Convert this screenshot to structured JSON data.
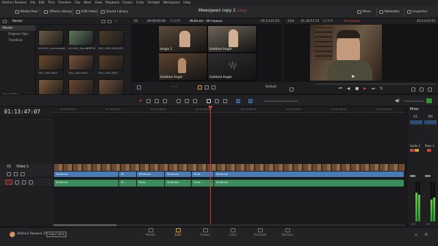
{
  "menu": [
    "DaVinci Resolve",
    "File",
    "Edit",
    "Trim",
    "Timeline",
    "Clip",
    "Mark",
    "View",
    "Playback",
    "Fusion",
    "Color",
    "Fairlight",
    "Workspace",
    "Help"
  ],
  "toolbar": {
    "media_pool": "Media Pool",
    "effects_library": "Effects Library",
    "edit_index": "Edit Index",
    "sound_library": "Sound Library",
    "project_title": "Мемориал copy 2",
    "edited": "Edited",
    "mixer": "Mixer",
    "metadata": "Metadata",
    "inspector": "Inspector"
  },
  "bin_header": {
    "title": "Master"
  },
  "bins": [
    "Master",
    "Original Clips",
    "Timelines"
  ],
  "smart_bins": "Smart Bins",
  "clips": [
    {
      "label": "A2-0001_uncheckedA...",
      "color": "#6a5a44"
    },
    {
      "label": "A2-0001_SkynNBRFW...",
      "color": "#5d7a5d"
    },
    {
      "label": "DSC_0001-0001.JPG",
      "color": "#4a3a2a"
    },
    {
      "label": "DSC_0001.MOV",
      "color": "#6b4a2e"
    },
    {
      "label": "DSC_0002.MOV",
      "color": "#7a5236"
    },
    {
      "label": "DSC_0003.MOV",
      "color": "#5a3e28"
    },
    {
      "label": "DSC_0004.MOV",
      "color": "#805a38"
    },
    {
      "label": "DSC_0005.MOV",
      "color": "#6a4630"
    },
    {
      "label": "DSC_0006.MOV",
      "color": "#74503a"
    }
  ],
  "source_viewer": {
    "fit": "Fit",
    "timecode_in": "00:00:04:09",
    "fps": "23.976",
    "title": "Multicam - Интервью",
    "timecode": "01:13:47:03",
    "angles": [
      {
        "label": "Angle 1",
        "color": "#5b4a3a"
      },
      {
        "label": "Untitled Angle",
        "color": "#6d6358"
      },
      {
        "label": "Untitled Angle",
        "color": "#5c4330"
      },
      {
        "label": "Untitled Angle",
        "color": "#2c2c30"
      }
    ],
    "display": "Default"
  },
  "timeline_viewer": {
    "zoom": "23%",
    "timecode_dur": "01:16:57:15",
    "fps": "23.976",
    "title": "Интервью",
    "timecode": "01:13:47:03"
  },
  "timeline": {
    "timecode": "01:13:47:07",
    "ruler": [
      "01:13:06:00",
      "01:13:16:00",
      "01:13:26:00",
      "01:13:36:00",
      "01:13:46:00",
      "01:13:56:00",
      "01:14:06:00",
      "01:14:16:00",
      "01:14:26:00"
    ],
    "video_track": {
      "id": "V1",
      "name": "Video 1"
    },
    "audio_track": {
      "id": "A1"
    },
    "clips_v": [
      {
        "name": "Multicam"
      },
      {
        "name": "M..."
      },
      {
        "name": "Multicam"
      },
      {
        "name": "Multicam"
      },
      {
        "name": "Multi..."
      },
      {
        "name": "Multicam"
      }
    ],
    "clips_a": [
      {
        "name": "Multicam"
      },
      {
        "name": "M..."
      },
      {
        "name": "Multi..."
      },
      {
        "name": "Multicam"
      },
      {
        "name": "Multi..."
      },
      {
        "name": "Multicam"
      }
    ]
  },
  "mixer": {
    "title": "Mixer",
    "ch1": "A1",
    "ch2": "M1",
    "bus1": "Audio 1",
    "bus2": "Main 1",
    "levels": [
      0.72,
      0.68,
      0.55,
      0.6
    ],
    "fader": "0.0",
    "fader2": "0.0"
  },
  "pages": [
    "Media",
    "Edit",
    "Fusion",
    "Color",
    "Fairlight",
    "Deliver"
  ],
  "active_page": "Edit",
  "footer": {
    "app": "DaVinci Resolve 15",
    "badge": "PUBLIC BETA"
  },
  "colors": {
    "accent": "#e7a74a",
    "video_clip": "#4a7bb4",
    "audio_clip": "#3a8c5c",
    "playhead": "#d6423a"
  }
}
